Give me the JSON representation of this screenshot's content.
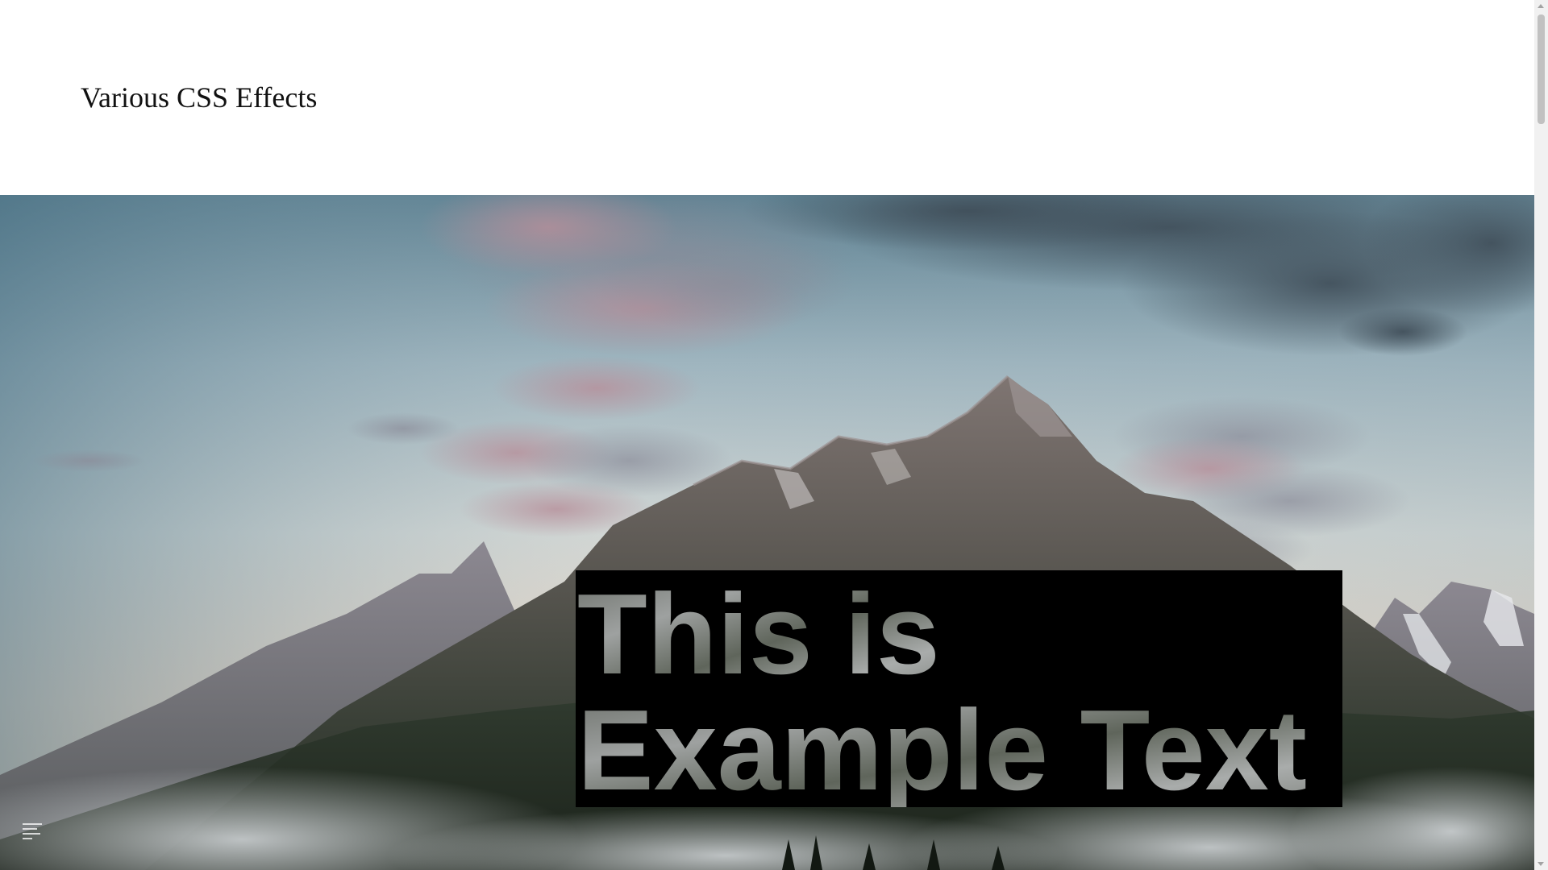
{
  "header": {
    "title": "Various CSS Effects"
  },
  "hero": {
    "image_icon": "mountain-landscape-image",
    "headline_line1": "This is",
    "headline_line2": "Example Text"
  },
  "menu": {
    "icon": "menu-lines-icon"
  },
  "colors": {
    "text_box_background": "#000000",
    "page_background": "#ffffff",
    "scrollbar_track": "#f1f1f1",
    "scrollbar_thumb": "#c1c1c1"
  }
}
